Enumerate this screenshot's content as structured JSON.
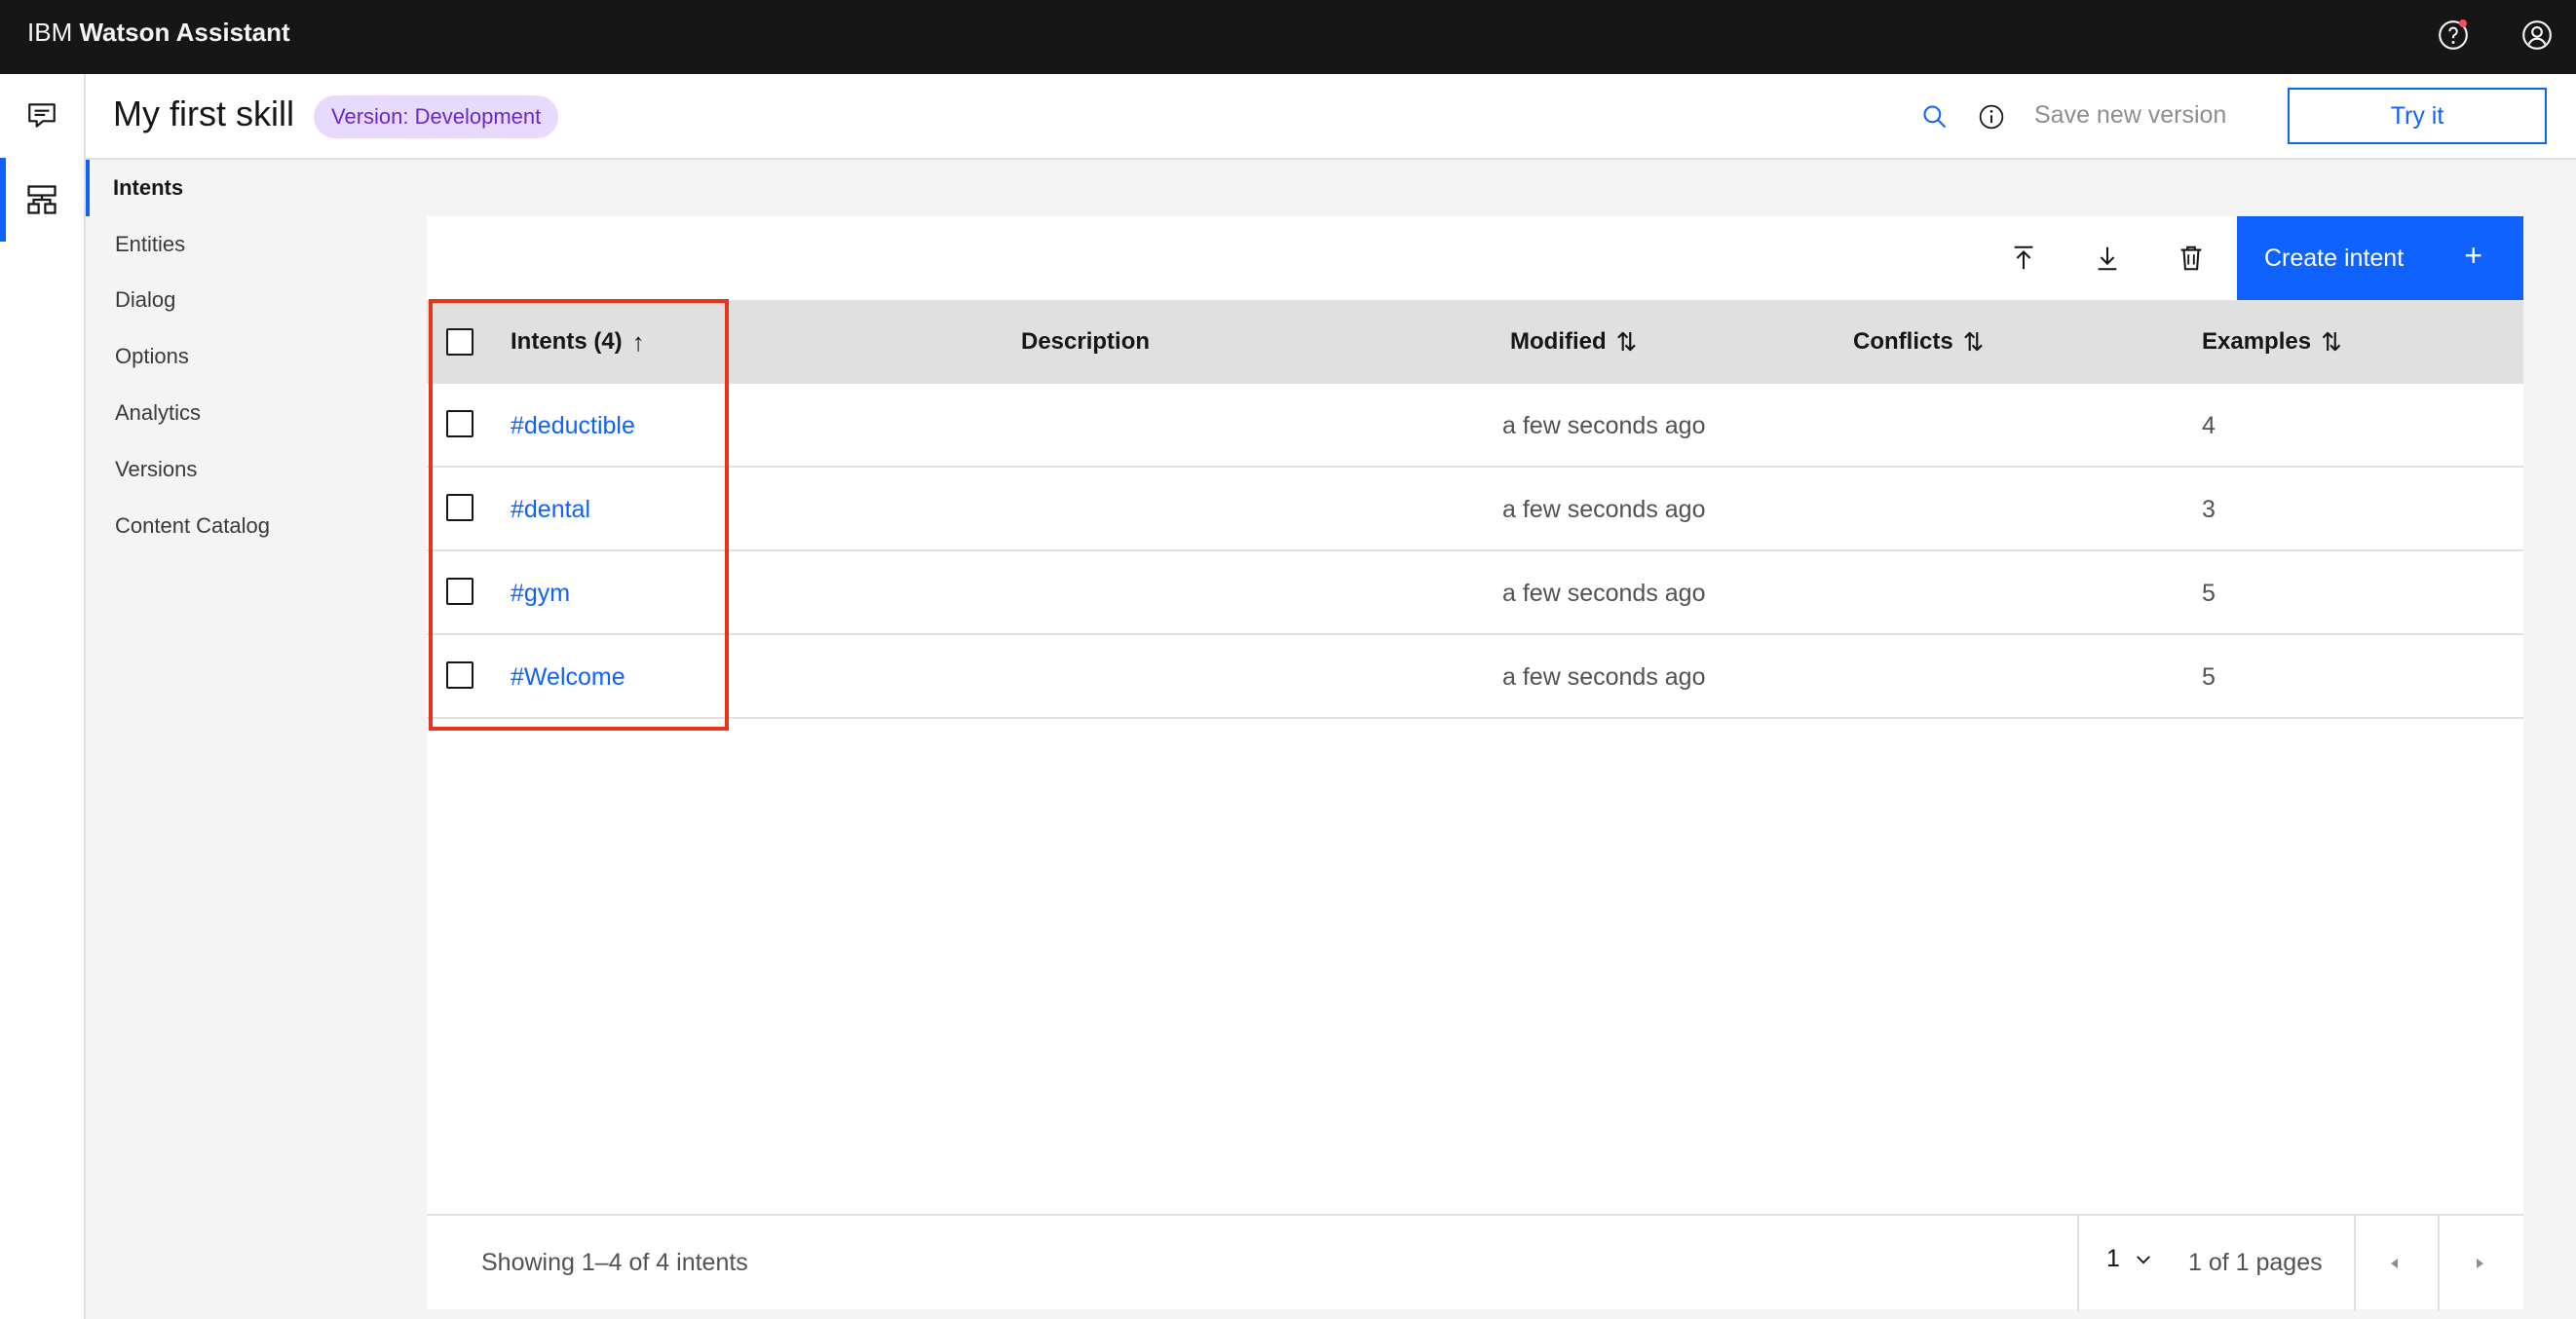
{
  "app": {
    "brand_light": "IBM",
    "brand_bold": "Watson Assistant",
    "help_icon": "help-icon",
    "user_icon": "user-avatar-icon"
  },
  "rail": {
    "items": [
      {
        "icon": "chat-icon",
        "active": false
      },
      {
        "icon": "skills-icon",
        "active": true
      }
    ]
  },
  "skill": {
    "title": "My first skill",
    "version_badge": "Version: Development",
    "save_version_label": "Save new version",
    "try_label": "Try it"
  },
  "subnav": {
    "items": [
      {
        "label": "Intents",
        "active": true
      },
      {
        "label": "Entities",
        "active": false
      },
      {
        "label": "Dialog",
        "active": false
      },
      {
        "label": "Options",
        "active": false
      },
      {
        "label": "Analytics",
        "active": false
      },
      {
        "label": "Versions",
        "active": false
      },
      {
        "label": "Content Catalog",
        "active": false
      }
    ]
  },
  "toolbar": {
    "create_label": "Create intent",
    "create_plus": "+"
  },
  "table": {
    "headers": {
      "intents": "Intents (4)",
      "intents_sort": "↑",
      "description": "Description",
      "modified": "Modified",
      "modified_sort": "⇅",
      "conflicts": "Conflicts",
      "conflicts_sort": "⇅",
      "examples": "Examples",
      "examples_sort": "⇅"
    },
    "rows": [
      {
        "name": "#deductible",
        "modified": "a few seconds ago",
        "examples": "4"
      },
      {
        "name": "#dental",
        "modified": "a few seconds ago",
        "examples": "3"
      },
      {
        "name": "#gym",
        "modified": "a few seconds ago",
        "examples": "5"
      },
      {
        "name": "#Welcome",
        "modified": "a few seconds ago",
        "examples": "5"
      }
    ]
  },
  "pagination": {
    "showing": "Showing 1–4 of 4 intents",
    "page": "1",
    "of_pages": "1 of 1 pages"
  },
  "colors": {
    "accent": "#0f62fe",
    "header_bg": "#161616",
    "badge_bg": "#e8daff",
    "badge_text": "#6929c4",
    "highlight": "#e8331c"
  }
}
